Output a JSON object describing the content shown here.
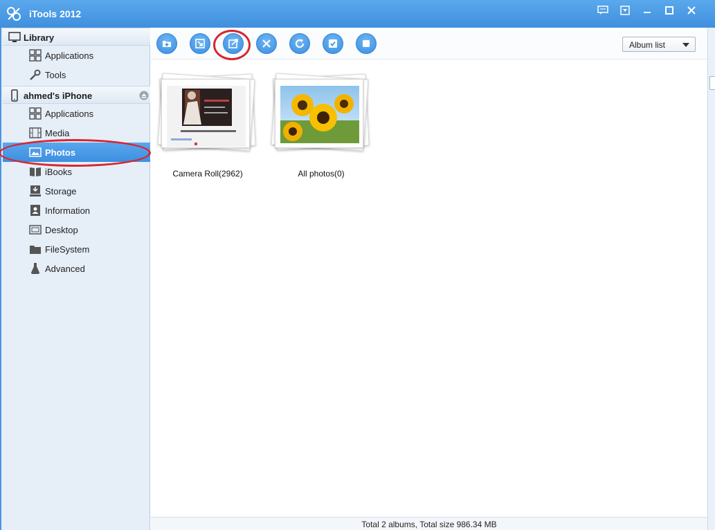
{
  "window": {
    "title": "iTools 2012",
    "controls": [
      "feedback-icon",
      "menu-dropdown-icon",
      "minimize-icon",
      "maximize-icon",
      "close-icon"
    ]
  },
  "sidebar": {
    "library": {
      "title": "Library",
      "icon": "computer-icon",
      "items": [
        {
          "label": "Applications",
          "icon": "apps-grid-icon"
        },
        {
          "label": "Tools",
          "icon": "wrench-icon"
        }
      ]
    },
    "device": {
      "title": "ahmed's iPhone",
      "icon": "phone-icon",
      "items": [
        {
          "label": "Applications",
          "icon": "apps-grid-icon"
        },
        {
          "label": "Media",
          "icon": "film-icon"
        },
        {
          "label": "Photos",
          "icon": "photo-icon",
          "active": true
        },
        {
          "label": "iBooks",
          "icon": "book-icon"
        },
        {
          "label": "Storage",
          "icon": "storage-icon"
        },
        {
          "label": "Information",
          "icon": "contact-card-icon"
        },
        {
          "label": "Desktop",
          "icon": "desktop-icon"
        },
        {
          "label": "FileSystem",
          "icon": "folder-icon"
        },
        {
          "label": "Advanced",
          "icon": "flask-icon"
        }
      ]
    }
  },
  "toolbar": {
    "buttons": [
      "new-album-icon",
      "import-icon",
      "export-icon",
      "delete-icon",
      "refresh-icon",
      "select-all-icon",
      "stop-icon"
    ],
    "view_select": "Album list"
  },
  "albums": [
    {
      "name": "Camera Roll(2962)"
    },
    {
      "name": "All photos(0)"
    }
  ],
  "status": {
    "text": "Total 2 albums, Total size 986.34 MB"
  },
  "colors": {
    "accent": "#3f8fde",
    "highlight_ring": "#d8262e"
  }
}
